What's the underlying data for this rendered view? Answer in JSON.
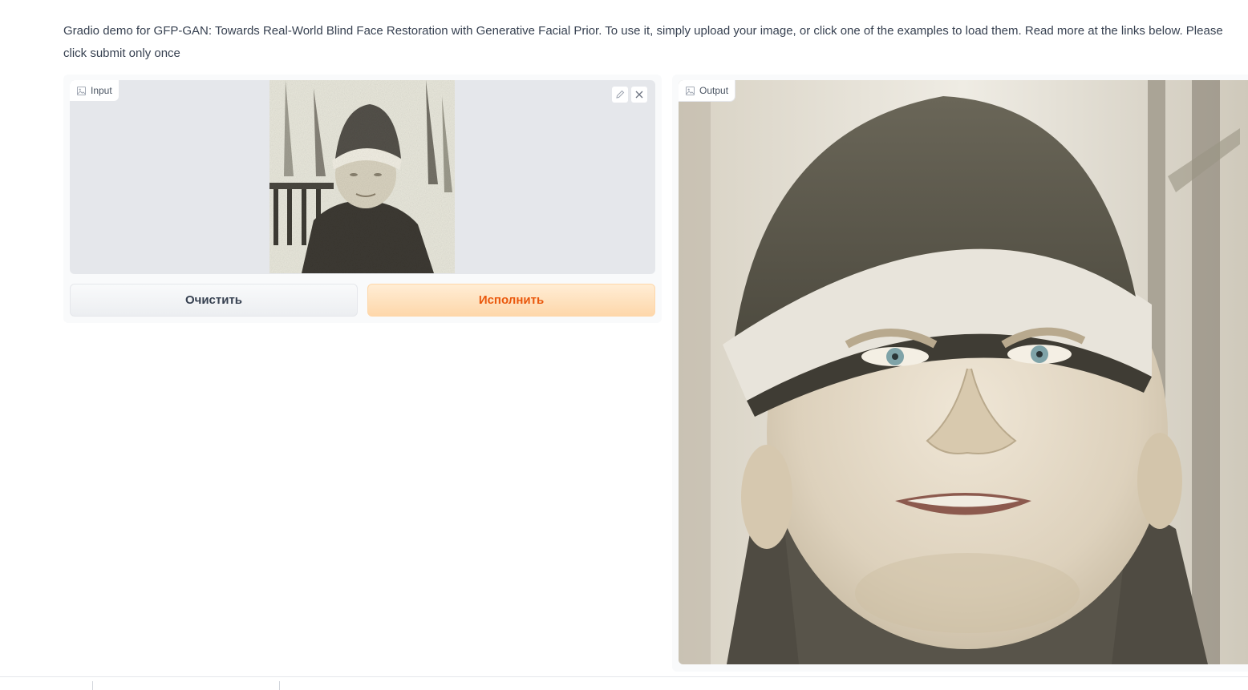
{
  "description": "Gradio demo for GFP-GAN: Towards Real-World Blind Face Restoration with Generative Facial Prior. To use it, simply upload your image, or click one of the examples to load them. Read more at the links below. Please click submit only once",
  "input": {
    "label": "Input",
    "icon": "image-icon",
    "tools": [
      "edit-icon",
      "close-icon"
    ]
  },
  "output": {
    "label": "Output",
    "icon": "image-icon"
  },
  "buttons": {
    "clear_label": "Очистить",
    "submit_label": "Исполнить"
  },
  "colors": {
    "primary_accent": "#ea580c",
    "primary_bg": "#fed7aa",
    "secondary_bg": "#f3f4f6",
    "image_bg": "#e5e7eb"
  }
}
